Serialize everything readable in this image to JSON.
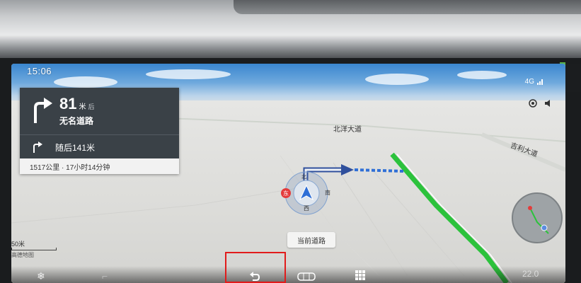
{
  "status_bar": {
    "time": "15:06",
    "network": "4G",
    "signal_icon": "signal-bars-icon"
  },
  "side_controls": {
    "left_icon": "mute-circle-icon",
    "right_icon": "volume-icon"
  },
  "guidance": {
    "distance": "81",
    "distance_unit": "米",
    "after_text": "后",
    "road_name": "无名道路",
    "next_maneuver": "随后141米",
    "trip_summary": "1517公里 · 17小时14分钟",
    "turn_icon": "turn-right-arrow-icon"
  },
  "map": {
    "road_labels": [
      "北洋大道",
      "吉利大道"
    ],
    "compass": {
      "north": "北",
      "south": "南",
      "west": "西",
      "east": "东"
    },
    "current_road_label": "当前道路",
    "scale_text": "50米",
    "scale_sub": "高德地图"
  },
  "colors": {
    "route_blue": "#2f6fd6",
    "route_green": "#2cc23c",
    "card_bg": "#3a4147"
  },
  "bottom_bar": {
    "icons": [
      "fan-icon",
      "seat-icon",
      "back-icon",
      "grid-icon",
      "apps-grid-icon"
    ],
    "right_readout": "22.0"
  }
}
